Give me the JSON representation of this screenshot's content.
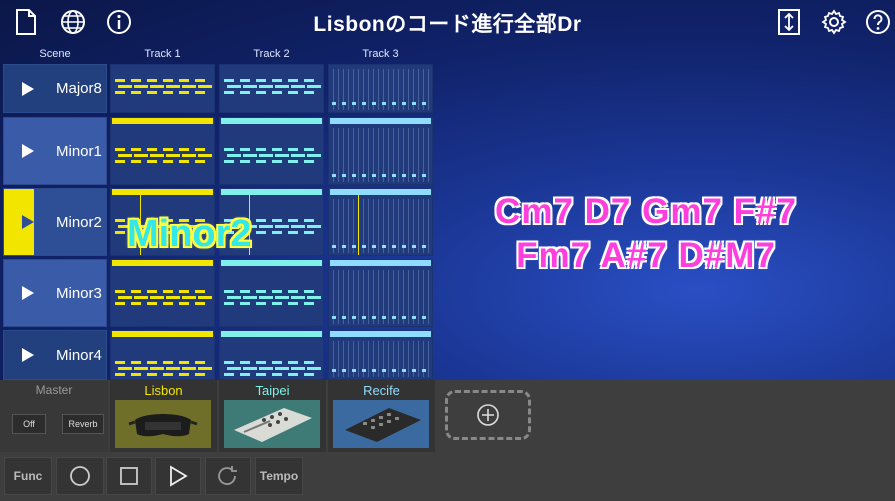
{
  "header": {
    "title": "Lisbonのコード進行全部Dr",
    "icons": [
      "document-icon",
      "globe-icon",
      "info-icon",
      "resize-icon",
      "gear-icon",
      "help-icon"
    ]
  },
  "columns": {
    "scene": "Scene",
    "track1": "Track 1",
    "track2": "Track 2",
    "track3": "Track 3"
  },
  "scenes": [
    {
      "name": "Major8"
    },
    {
      "name": "Minor1"
    },
    {
      "name": "Minor2"
    },
    {
      "name": "Minor3"
    },
    {
      "name": "Minor4"
    }
  ],
  "overlay": {
    "scene_name": "Minor2",
    "chord_line1": "Cm7  D7  Gm7  F#7",
    "chord_line2": "Fm7  A#7  D#M7"
  },
  "mixer": {
    "master_label": "Master",
    "off_label": "Off",
    "reverb_label": "Reverb"
  },
  "instruments": [
    {
      "name": "Lisbon",
      "color": "#f2e600"
    },
    {
      "name": "Taipei",
      "color": "#7ff0ea"
    },
    {
      "name": "Recife",
      "color": "#8fdcff"
    }
  ],
  "transport": {
    "func_label": "Func",
    "tempo_label": "Tempo"
  },
  "colors": {
    "track1": "#f2e600",
    "track2": "#7ff0ea",
    "track3": "#8fdcff",
    "chord_text": "#ff3fdc",
    "overlay_text": "#35e8e8"
  }
}
